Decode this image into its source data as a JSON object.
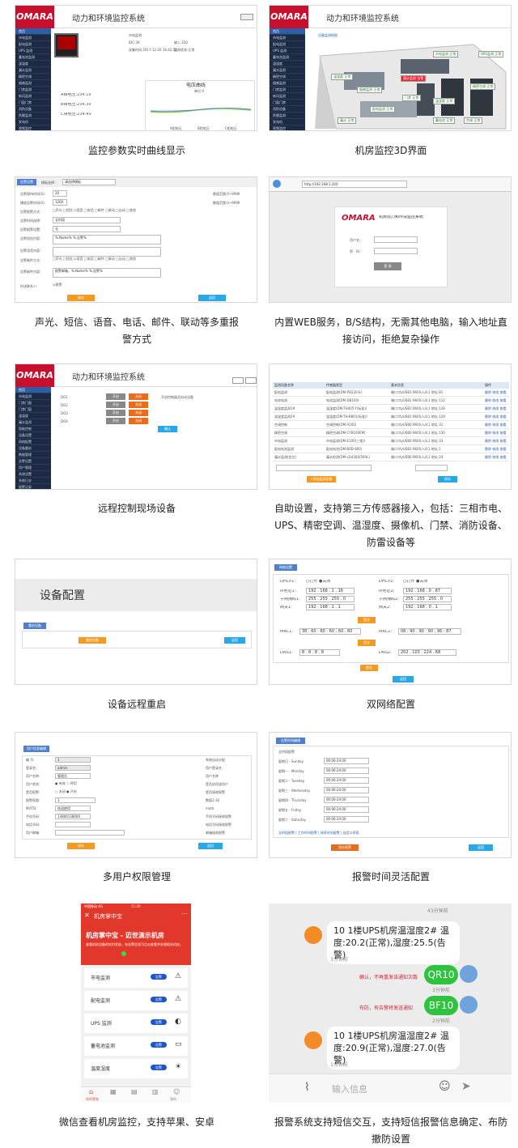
{
  "app_title": "动力和环境监控系统",
  "logo": "OMARA",
  "captions": [
    "监控参数实时曲线显示",
    "机房监控3D界面",
    "声光、短信、语音、电话、邮件、联动等多重报警方式",
    "内置WEB服务，B/S结构，无需其他电脑，输入地址直接访问，拒绝复杂操作",
    "远程控制现场设备",
    "自助设置，支持第三方传感器接入，包括：三相市电、UPS、精密空调、温湿度、摄像机、门禁、消防设备、防雷设备等",
    "设备远程重启",
    "双网络配置",
    "多用户权限管理",
    "报警时间灵活配置",
    "微信查看机房监控，支持苹果、安卓",
    "报警系统支持短信交互，支持短信报警信息确定、布防撤防设置"
  ],
  "p1": {
    "menu": [
      "首页",
      "市电监测",
      "配电监测",
      "UPS 监测",
      "蓄电池监测",
      "温湿度",
      "漏水监测",
      "精密空调",
      "烟感监测",
      "门禁监测",
      "新风监测",
      "门窗门禁",
      "消防设备",
      "防雷监测",
      "发电机",
      "视频监控",
      "报警信息"
    ],
    "fields": [
      "市电监测",
      "IDC:39",
      "输入:220",
      "采集时间:2017-12-20 16:42:50",
      "监测状态:正常"
    ],
    "voltages": [
      "A相电压:234.1V",
      "B相电压:234.3V",
      "C相电压:234.4V"
    ],
    "chart_title": "电压曲线",
    "chart_sub": "单位:V",
    "legend": [
      "A相电压",
      "B相电压",
      "C相电压"
    ]
  },
  "p2": {
    "label": "设备监测地图",
    "tags": [
      "市电监测 正常",
      "UPS监测 正常",
      "温湿度 正常",
      "漏水监测 告警",
      "精密空调 正常",
      "烟感监测 正常",
      "门禁 正常",
      "温湿度 正常",
      "配电监测 正常",
      "蓄电池 正常",
      "空调 正常",
      "漏水 正常"
    ]
  },
  "p3": {
    "tab": "告警设置",
    "template_label": "模板选择：",
    "template_value": "请选择模板",
    "rows": [
      [
        "告警保持时间(S):",
        "20",
        "数值范围:0~9999"
      ],
      [
        "播放告警时间(S):",
        "1260",
        "数值范围:0~9999"
      ],
      [
        "告警报警方式:",
        "□声光 □短信 ☑语音 □电话 □邮件 □联动 □自动 □其他",
        ""
      ],
      [
        "告警时间选择:",
        "全时段",
        ""
      ],
      [
        "告警报警设置:",
        "无",
        ""
      ],
      [
        "告警短信内容:",
        "%.Name% %.告警%",
        ""
      ],
      [
        "告警语音内容:",
        "",
        ""
      ],
      [
        "告警邮件方式:",
        "□声光 □短信 ☑语音 □电话 □邮件 □联动 □自动 □其他",
        ""
      ],
      [
        "告警邮件内容:",
        "报警邮箱，%.Name% %.告警%",
        ""
      ],
      [
        "抄送联系人:",
        "☑报警",
        ""
      ]
    ],
    "save": "保存",
    "back": "返回"
  },
  "p4": {
    "url": "http://192.168.1.200",
    "login_title": "机房动力和环境监控系统",
    "user_label": "用户名：",
    "pass_label": "密　码：",
    "login_btn": "登 录"
  },
  "p5": {
    "menu": [
      "首页",
      "市电监测",
      "门禁门窗",
      "门禁门窗",
      "温湿度",
      "漏水监测",
      "智能控制",
      "设备设置",
      "网络配置",
      "设备重启",
      "数据管理",
      "告警设置",
      "用户管理",
      "系统设置",
      "系统日志",
      "报警记录"
    ],
    "rows": [
      [
        "DO1",
        "开启",
        "关闭"
      ],
      [
        "DO2",
        "开启",
        "关闭"
      ],
      [
        "DO3",
        "开启",
        "关闭"
      ],
      [
        "DO4",
        "开启",
        "关闭"
      ]
    ],
    "ok": "确认",
    "note": "开启控制器及启动设备"
  },
  "p6": {
    "headers": [
      "监测设备名称",
      "传感器类型",
      "基本信息",
      "操作"
    ],
    "rows": [
      [
        "配电监测",
        "配电监测(DM-PD220-E)",
        "端口:ttyUSB1:9600,n,8,1 地址:81",
        "删除 修改 查看"
      ],
      [
        "电池电测",
        "电池监测(DM-DB100)",
        "端口:ttyUSB1:9600,n,8,1 地址:112",
        "删除 修改 查看"
      ],
      [
        "温湿度监测1#",
        "温湿度(DM-TH405-Y(标准))",
        "端口:ttyUSB1:9600,n,8,1 地址:128",
        "删除 修改 查看"
      ],
      [
        "温湿度监测2#",
        "温湿度(DM-TH-B801(标准))",
        "端口:ttyUSB1:9600,n,8,1 地址:129",
        "删除 修改 查看"
      ],
      [
        "空调控制",
        "空调控制(DM-A100)",
        "端口:ttyUSB0:9600,n,8,1 地址:31",
        "删除 修改 查看"
      ],
      [
        "精密空调",
        "精密空调(DM-CYB100EM)",
        "端口:ttyUSB0:9600,n,8,1 地址:130",
        "删除 修改 查看"
      ],
      [
        "市电监测",
        "市电监测(DM-E100(三相))",
        "端口:ttyUSB0:9600,n,8,1 地址:33",
        "删除 修改 查看"
      ],
      [
        "配电电池监测",
        "配电电池(DM-B0D-800)",
        "端口:ttyUSB1:9600,n,8,1 地址:1",
        "删除 修改 查看"
      ],
      [
        "漏水监测(定位)",
        "漏水检测(DM-LD4300/500L)",
        "端口:ttyUSB0:9600,n,8,1 地址:24",
        "删除 修改 查看"
      ]
    ],
    "add": "+添加监测设备",
    "save": "保存"
  },
  "p7": {
    "title": "设备配置",
    "tab": "重启设备",
    "restart": "重启设备",
    "back": "返回"
  },
  "p8": {
    "tab": "网络设置",
    "dhcp1": "DHCP1:",
    "dhcp2": "DHCP2:",
    "opt": "○打开 ●关闭",
    "ip1": "192 . 168 . 1 . 16",
    "ip2": "192 . 168 . 0 . 87",
    "mask1": "255 . 255 . 255 . 0",
    "mask2": "255 . 255 . 255 . 0",
    "gw1": "192 . 168 . 1 . 1",
    "gw2": "192 . 168 . 0 . 1",
    "mac1": "38 : 60 : 60 : 60 : 60 : 60",
    "mac2": "08 : 90 : 90 : 90 : 96 : 87",
    "dns1": "8 . 8 . 8 . 8",
    "dns2": "202 . 103 . 224 . 68",
    "lbl_ip1": "IP地址1:",
    "lbl_ip2": "IP地址2:",
    "lbl_mask1": "子网掩码1:",
    "lbl_mask2": "子网掩码2:",
    "lbl_gw1": "网关1:",
    "lbl_gw2": "网关2:",
    "lbl_mac1": "MAC1:",
    "lbl_mac2": "MAC2:",
    "lbl_dns1": "DNS1:",
    "lbl_dns2": "DNS2:",
    "submit": "提交",
    "back": "返回"
  },
  "p9": {
    "tab": "用户信息编辑",
    "rows": [
      [
        "编 号:",
        "1",
        "系统自动分配"
      ],
      [
        "登录名:",
        "admin",
        "用户登录名"
      ],
      [
        "用户名称:",
        "管理员",
        "用户名称"
      ],
      [
        "用户状态:",
        "● 有效 ○ 停用",
        "是否启用该用户"
      ],
      [
        "是否报警:",
        "○ 关闭 ● 开启",
        "是否接收报警"
      ],
      [
        "报警权限:",
        "1",
        "数值1-16"
      ],
      [
        "MOTD:",
        "欢迎使用",
        "motd"
      ],
      [
        "手机号码:",
        "13800138000",
        "手机号码接收报警"
      ],
      [
        "电话号码:",
        "",
        "电话号码接收报警"
      ],
      [
        "用户邮箱:",
        "",
        "邮箱接收报警"
      ]
    ],
    "save": "保存",
    "back": "返回"
  },
  "p10": {
    "tab": "告警时间编辑",
    "label": "全时段报警",
    "days": [
      "星期日 - Sunday",
      "星期一 - Monday",
      "星期二 - Tuesday",
      "星期三 - Wednesday",
      "星期四 - Thursday",
      "星期五 - Friday",
      "星期六 - Saturday"
    ],
    "time": "00:00-24:00",
    "links": "全时段报警 | 工作时间报警 | 休息时间报警 | 自定义时段",
    "save": "保存报警",
    "back": "返回"
  },
  "p11": {
    "status_left": "中国移动 4G",
    "status_time": "11:20",
    "title": "机房掌中宝",
    "header": "机房掌中宝 - 迈世演示机房",
    "sub": "查看机房设备的实时状态，有告警信息可点击查看并处理相关机房。",
    "items": [
      "市电监测",
      "配电监测",
      "UPS 监测",
      "蓄电池监测",
      "温度湿度"
    ],
    "badge": "告警",
    "tabs": [
      "实时状态",
      "",
      "",
      "",
      "我的"
    ]
  },
  "p12": {
    "t_top": "43分钟前",
    "msg1": "10 1楼UPS机房温湿度2# 温度:20.2(正常),湿度:25.5(告警)",
    "t1": "3分钟前",
    "reply1_note": "确认，不再重发该通知次数",
    "reply1": "QR10",
    "t2": "3分钟前",
    "reply2_note": "布防，有告警将发送通知",
    "reply2": "BF10",
    "t3": "2分钟前",
    "msg2": "10 1楼UPS机房温湿度2# 温度:20.9(正常),湿度:27.0(告警)",
    "t4": "1分钟前",
    "input": "输入信息"
  }
}
